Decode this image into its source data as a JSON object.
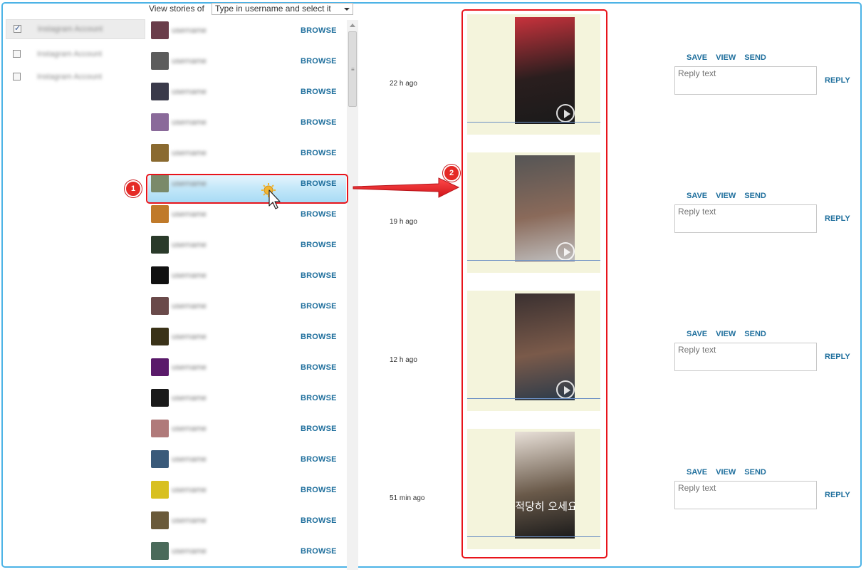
{
  "accounts": [
    {
      "label": "Instagram Account",
      "checked": true
    },
    {
      "label": "Instagram Account",
      "checked": false
    },
    {
      "label": "Instagram Account",
      "checked": false
    }
  ],
  "filter": {
    "label": "View stories of",
    "placeholder": "Type in username and select it"
  },
  "users": [
    {
      "name": "username",
      "browse": "BROWSE",
      "avatar_color": "#6a3d4a"
    },
    {
      "name": "username",
      "browse": "BROWSE",
      "avatar_color": "#5c5c5c"
    },
    {
      "name": "username",
      "browse": "BROWSE",
      "avatar_color": "#3a3a4a"
    },
    {
      "name": "username",
      "browse": "BROWSE",
      "avatar_color": "#8a6a9a"
    },
    {
      "name": "username",
      "browse": "BROWSE",
      "avatar_color": "#8a6a30"
    },
    {
      "name": "username",
      "browse": "BROWSE",
      "avatar_color": "#7a8a6a"
    },
    {
      "name": "username",
      "browse": "BROWSE",
      "avatar_color": "#c07a2a"
    },
    {
      "name": "username",
      "browse": "BROWSE",
      "avatar_color": "#2a3a2a"
    },
    {
      "name": "username",
      "browse": "BROWSE",
      "avatar_color": "#111111"
    },
    {
      "name": "username",
      "browse": "BROWSE",
      "avatar_color": "#6a4a4a"
    },
    {
      "name": "username",
      "browse": "BROWSE",
      "avatar_color": "#3a3218"
    },
    {
      "name": "username",
      "browse": "BROWSE",
      "avatar_color": "#5a1a6a"
    },
    {
      "name": "username",
      "browse": "BROWSE",
      "avatar_color": "#1a1a1a"
    },
    {
      "name": "username",
      "browse": "BROWSE",
      "avatar_color": "#b07a7a"
    },
    {
      "name": "username",
      "browse": "BROWSE",
      "avatar_color": "#3a5a7a"
    },
    {
      "name": "username",
      "browse": "BROWSE",
      "avatar_color": "#d8c020"
    },
    {
      "name": "username",
      "browse": "BROWSE",
      "avatar_color": "#6a5a3a"
    },
    {
      "name": "username",
      "browse": "BROWSE",
      "avatar_color": "#4a6a5a"
    }
  ],
  "selected_user_index": 5,
  "callouts": {
    "step1": "1",
    "step2": "2"
  },
  "stories": [
    {
      "time": "22 h ago",
      "thumb_colors": [
        "#c8323c",
        "#2a1e1e",
        "#1a1a1a"
      ],
      "has_play": true,
      "caption": ""
    },
    {
      "time": "19 h ago",
      "thumb_colors": [
        "#555555",
        "#8a6a5a",
        "#c0c0c0"
      ],
      "has_play": true,
      "caption": ""
    },
    {
      "time": "12 h ago",
      "thumb_colors": [
        "#3a3030",
        "#7a5a4a",
        "#2a3a4a"
      ],
      "has_play": true,
      "caption": ""
    },
    {
      "time": "51 min ago",
      "thumb_colors": [
        "#e8e0d8",
        "#6a5a4a",
        "#1a1a1a"
      ],
      "has_play": false,
      "caption": "적당히 오세요"
    }
  ],
  "story_actions": {
    "save": "SAVE",
    "view": "VIEW",
    "send": "SEND"
  },
  "reply": {
    "placeholder": "Reply text",
    "button": "REPLY"
  },
  "colors": {
    "accent": "#1f6f9d",
    "callout_red": "#e8141b",
    "frame_border": "#4cb3e6",
    "story_bg": "#f4f4dc"
  }
}
